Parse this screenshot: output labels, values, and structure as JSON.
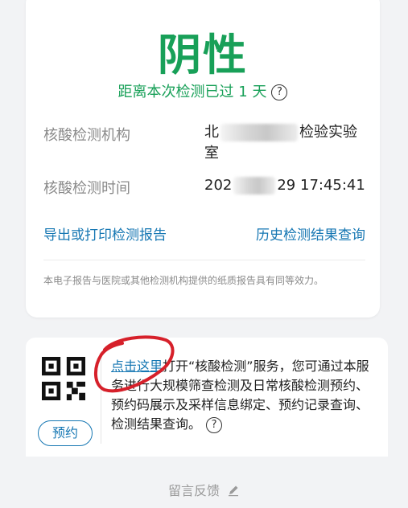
{
  "result": {
    "status": "阴性",
    "elapsed_prefix": "距离本次检测已过 1 天",
    "help_glyph": "?"
  },
  "details": {
    "institution_label": "核酸检测机构",
    "institution_line1_start": "北",
    "institution_line1_end": "检验实验",
    "institution_line2": "室",
    "time_label": "核酸检测时间",
    "time_start": "202",
    "time_end": "29 17:45:41"
  },
  "actions": {
    "export_label": "导出或打印检测报告",
    "history_label": "历史检测结果查询"
  },
  "disclaimer": "本电子报告与医院或其他检测机构提供的纸质报告具有同等效力。",
  "service": {
    "reserve_label": "预约",
    "link_text": "点击这里",
    "description_rest": "打开“核酸检测”服务，您可通过本服务进行大规模筛查检测及日常核酸检测预约、预约码展示及采样信息绑定、预约记录查询、检测结果查询。",
    "help_glyph": "?"
  },
  "footer": {
    "feedback_label": "留言反馈"
  },
  "colors": {
    "accent_green": "#18a058",
    "link_blue": "#1677b3",
    "annotation_red": "#d6202a"
  },
  "icons": [
    "help-circle-icon",
    "qr-code-icon",
    "pencil-icon"
  ]
}
